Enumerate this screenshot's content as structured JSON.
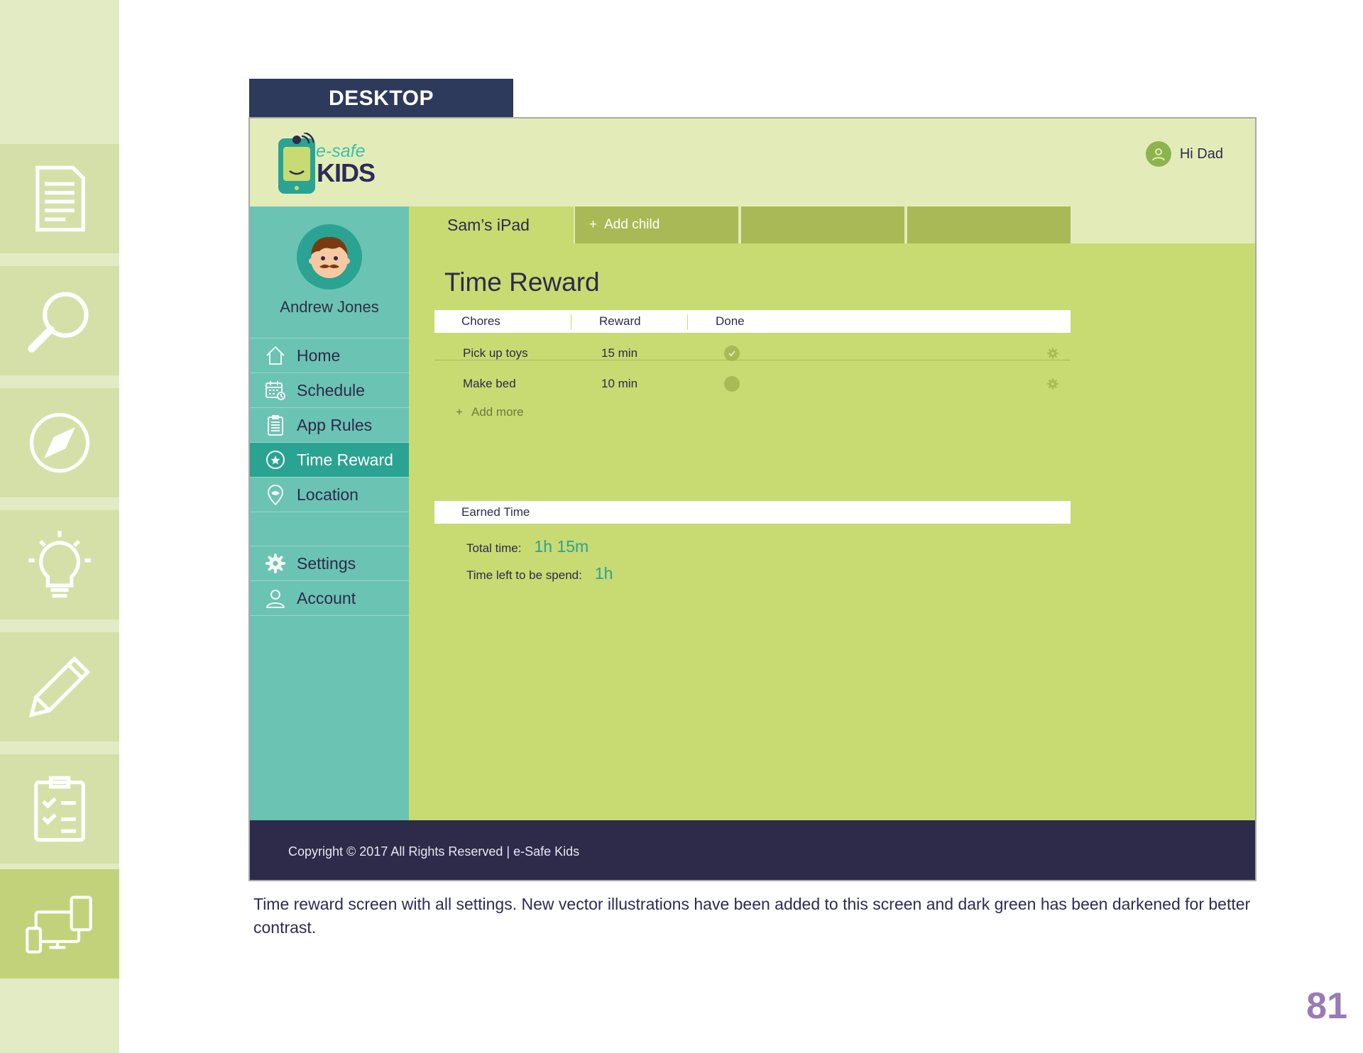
{
  "platform_tag": "DESKTOP",
  "app": {
    "logo_top": "e-safe",
    "logo_bottom": "KIDS",
    "greeting": "Hi Dad"
  },
  "sidebar": {
    "profile_name": "Andrew Jones",
    "items": [
      {
        "label": "Home"
      },
      {
        "label": "Schedule"
      },
      {
        "label": "App Rules"
      },
      {
        "label": "Time Reward"
      },
      {
        "label": "Location"
      }
    ],
    "secondary": [
      {
        "label": "Settings"
      },
      {
        "label": "Account"
      }
    ]
  },
  "tabs": {
    "active": "Sam’s iPad",
    "add_child": "Add child",
    "add_symbol": "+"
  },
  "main": {
    "title": "Time Reward",
    "table": {
      "headers": [
        "Chores",
        "Reward",
        "Done"
      ],
      "rows": [
        {
          "chore": "Pick up toys",
          "reward": "15 min",
          "done": true
        },
        {
          "chore": "Make bed",
          "reward": "10 min",
          "done": false
        }
      ],
      "add_more": "Add more",
      "add_symbol": "+"
    },
    "earned": {
      "header": "Earned Time",
      "total_label": "Total time:",
      "total_value": "1h 15m",
      "left_label": "Time left to be spend:",
      "left_value": "1h"
    }
  },
  "footer": {
    "copyright": "Copyright © 2017 All Rights Reserved | e-Safe Kids"
  },
  "caption": "Time reward screen with all settings. New vector illustrations have been added to this screen and dark green has been darkened for better contrast.",
  "page_number": "81",
  "colors": {
    "sidebar": "#6bc3b3",
    "active_nav": "#2aa392",
    "main_bg": "#c8da72",
    "header_bg": "#e3ecb8",
    "footer_bg": "#2d2a4a",
    "tab_dark": "#a9b956",
    "page_number": "#9a7bb5"
  }
}
